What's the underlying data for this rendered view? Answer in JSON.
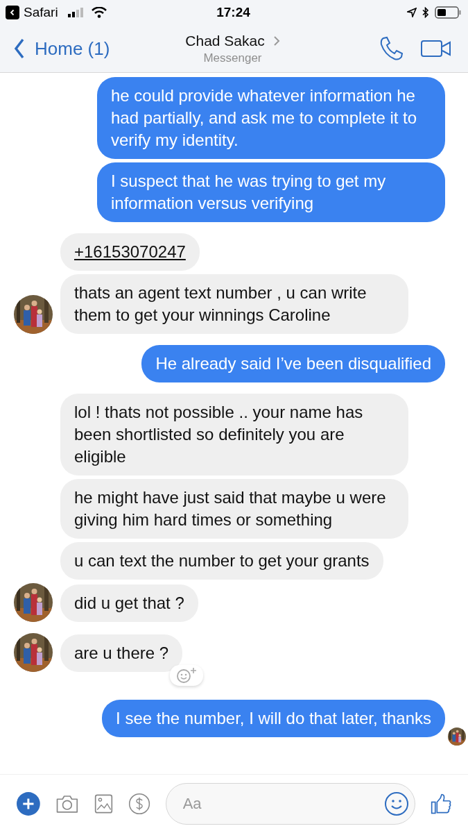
{
  "status_bar": {
    "back_app": "Safari",
    "time": "17:24"
  },
  "header": {
    "back": "Home (1)",
    "title": "Chad Sakac",
    "subtitle": "Messenger"
  },
  "groups": [
    {
      "kind": "sent",
      "seen": false,
      "messages": [
        {
          "kind": "text",
          "text": "he could provide whatever information he had partially, and ask me to complete it to verify my identity.",
          "reaction": false
        },
        {
          "kind": "text",
          "text": "I suspect that he was trying to get my information versus verifying",
          "reaction": false
        }
      ]
    },
    {
      "kind": "received",
      "seen": false,
      "messages": [
        {
          "kind": "link",
          "text": "+16153070247",
          "reaction": false
        },
        {
          "kind": "text",
          "text": "thats an agent text number , u can write them to get your winnings Caroline",
          "reaction": false
        }
      ]
    },
    {
      "kind": "sent",
      "seen": false,
      "messages": [
        {
          "kind": "text",
          "text": "He already said I’ve been disqualified",
          "reaction": false
        }
      ]
    },
    {
      "kind": "received",
      "seen": false,
      "messages": [
        {
          "kind": "text",
          "text": "lol ! thats not possible .. your name has been shortlisted so definitely you are eligible",
          "reaction": false
        },
        {
          "kind": "text",
          "text": "he might have just said that maybe u were giving him hard times or something",
          "reaction": false
        },
        {
          "kind": "text",
          "text": "u can text the number to get your grants",
          "reaction": false
        },
        {
          "kind": "text",
          "text": "did u get that ?",
          "reaction": false
        }
      ]
    },
    {
      "kind": "received",
      "seen": false,
      "messages": [
        {
          "kind": "text",
          "text": "are u there ?",
          "reaction": true
        }
      ]
    },
    {
      "kind": "sent",
      "seen": true,
      "messages": [
        {
          "kind": "text",
          "text": "I see the number, I will do that later, thanks",
          "reaction": false
        }
      ]
    }
  ],
  "composer": {
    "placeholder": "Aa"
  }
}
